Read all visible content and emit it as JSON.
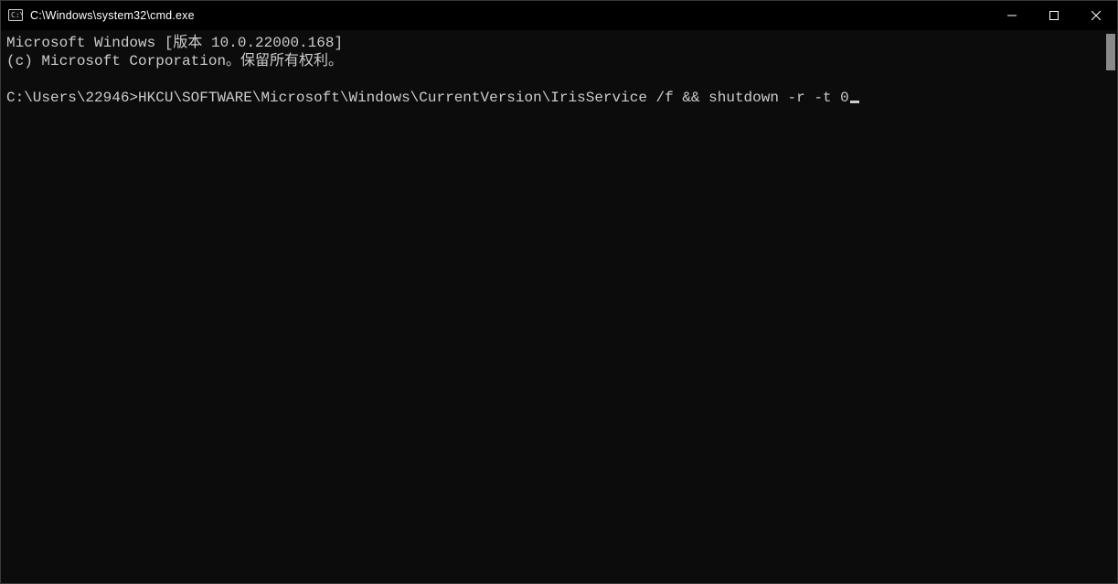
{
  "window": {
    "title": "C:\\Windows\\system32\\cmd.exe"
  },
  "terminal": {
    "line1": "Microsoft Windows [版本 10.0.22000.168]",
    "line2": "(c) Microsoft Corporation。保留所有权利。",
    "blank": "",
    "prompt": "C:\\Users\\22946>",
    "command": "HKCU\\SOFTWARE\\Microsoft\\Windows\\CurrentVersion\\IrisService /f && shutdown -r -t 0"
  },
  "colors": {
    "background": "#0c0c0c",
    "text": "#cccccc",
    "titlebar_bg": "#000000",
    "scrollbar_thumb": "#8a8a8a"
  }
}
